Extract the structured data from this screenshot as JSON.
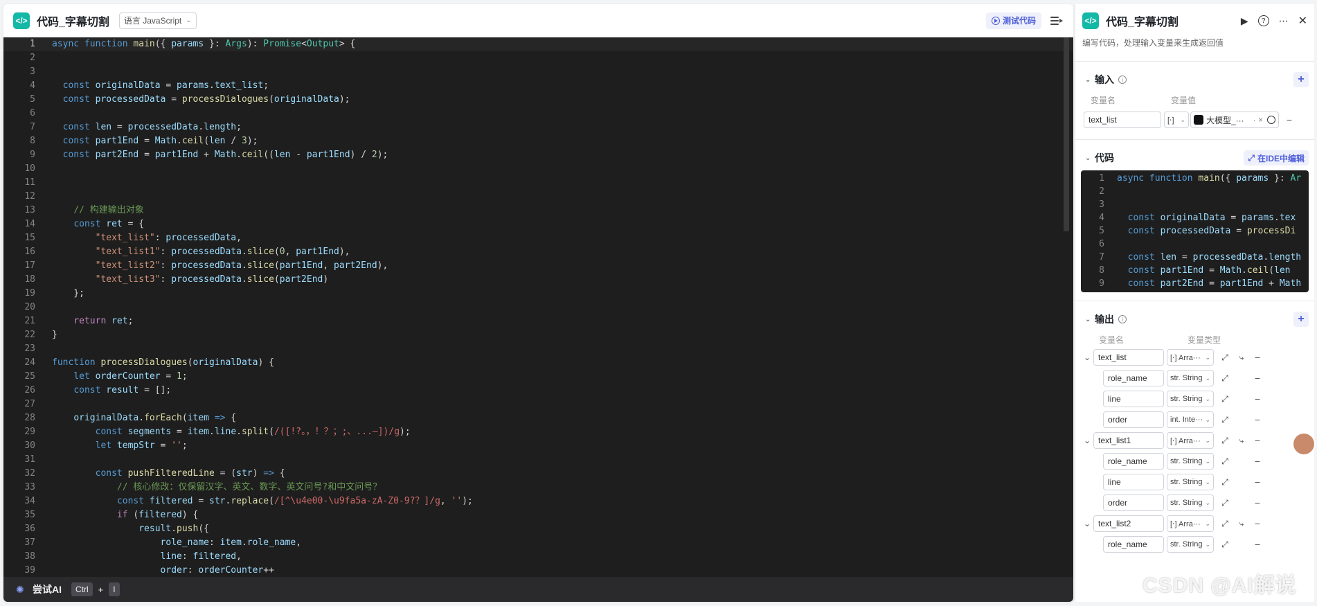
{
  "editor": {
    "title": "代码_字幕切割",
    "language": "语言 JavaScript",
    "test_button": "测试代码",
    "code_lines": [
      {
        "n": 1,
        "html": "<span class='k'>async</span> <span class='k'>function</span> <span class='f'>main</span>({ <span class='v'>params</span> }: <span class='t'>Args</span>): <span class='t'>Promise</span>&lt;<span class='t'>Output</span>&gt; {"
      },
      {
        "n": 2,
        "html": ""
      },
      {
        "n": 3,
        "html": ""
      },
      {
        "n": 4,
        "html": "  <span class='k'>const</span> <span class='v'>originalData</span> = <span class='v'>params</span>.<span class='v'>text_list</span>;"
      },
      {
        "n": 5,
        "html": "  <span class='k'>const</span> <span class='v'>processedData</span> = <span class='f'>processDialogues</span>(<span class='v'>originalData</span>);"
      },
      {
        "n": 6,
        "html": ""
      },
      {
        "n": 7,
        "html": "  <span class='k'>const</span> <span class='v'>len</span> = <span class='v'>processedData</span>.<span class='v'>length</span>;"
      },
      {
        "n": 8,
        "html": "  <span class='k'>const</span> <span class='v'>part1End</span> = <span class='v'>Math</span>.<span class='f'>ceil</span>(<span class='v'>len</span> / <span class='n'>3</span>);"
      },
      {
        "n": 9,
        "html": "  <span class='k'>const</span> <span class='v'>part2End</span> = <span class='v'>part1End</span> + <span class='v'>Math</span>.<span class='f'>ceil</span>((<span class='v'>len</span> - <span class='v'>part1End</span>) / <span class='n'>2</span>);"
      },
      {
        "n": 10,
        "html": ""
      },
      {
        "n": 11,
        "html": ""
      },
      {
        "n": 12,
        "html": ""
      },
      {
        "n": 13,
        "html": "    <span class='c'>// 构建输出对象</span>"
      },
      {
        "n": 14,
        "html": "    <span class='k'>const</span> <span class='v'>ret</span> = {"
      },
      {
        "n": 15,
        "html": "        <span class='s'>\"text_list\"</span>: <span class='v'>processedData</span>,"
      },
      {
        "n": 16,
        "html": "        <span class='s'>\"text_list1\"</span>: <span class='v'>processedData</span>.<span class='f'>slice</span>(<span class='n'>0</span>, <span class='v'>part1End</span>),"
      },
      {
        "n": 17,
        "html": "        <span class='s'>\"text_list2\"</span>: <span class='v'>processedData</span>.<span class='f'>slice</span>(<span class='v'>part1End</span>, <span class='v'>part2End</span>),"
      },
      {
        "n": 18,
        "html": "        <span class='s'>\"text_list3\"</span>: <span class='v'>processedData</span>.<span class='f'>slice</span>(<span class='v'>part2End</span>)"
      },
      {
        "n": 19,
        "html": "    };"
      },
      {
        "n": 20,
        "html": ""
      },
      {
        "n": 21,
        "html": "    <span class='kc'>return</span> <span class='v'>ret</span>;"
      },
      {
        "n": 22,
        "html": "}"
      },
      {
        "n": 23,
        "html": ""
      },
      {
        "n": 24,
        "html": "<span class='k'>function</span> <span class='f'>processDialogues</span>(<span class='v'>originalData</span>) {"
      },
      {
        "n": 25,
        "html": "    <span class='k'>let</span> <span class='v'>orderCounter</span> = <span class='n'>1</span>;"
      },
      {
        "n": 26,
        "html": "    <span class='k'>const</span> <span class='v'>result</span> = [];"
      },
      {
        "n": 27,
        "html": ""
      },
      {
        "n": 28,
        "html": "    <span class='v'>originalData</span>.<span class='f'>forEach</span>(<span class='v'>item</span> <span class='k'>=&gt;</span> {"
      },
      {
        "n": 29,
        "html": "        <span class='k'>const</span> <span class='v'>segments</span> = <span class='v'>item</span>.<span class='v'>line</span>.<span class='f'>split</span>(<span class='r'>/([!?。，！？；;、...—])/g</span>);"
      },
      {
        "n": 30,
        "html": "        <span class='k'>let</span> <span class='v'>tempStr</span> = <span class='s'>''</span>;"
      },
      {
        "n": 31,
        "html": ""
      },
      {
        "n": 32,
        "html": "        <span class='k'>const</span> <span class='f'>pushFilteredLine</span> = (<span class='v'>str</span>) <span class='k'>=&gt;</span> {"
      },
      {
        "n": 33,
        "html": "            <span class='c'>// 核心修改：仅保留汉字、英文、数字、英文问号?和中文问号？</span>"
      },
      {
        "n": 34,
        "html": "            <span class='k'>const</span> <span class='v'>filtered</span> = <span class='v'>str</span>.<span class='f'>replace</span>(<span class='r'>/[^\\u4e00-\\u9fa5a-zA-Z0-9?？]/g</span>, <span class='s'>''</span>);"
      },
      {
        "n": 35,
        "html": "            <span class='kc'>if</span> (<span class='v'>filtered</span>) {"
      },
      {
        "n": 36,
        "html": "                <span class='v'>result</span>.<span class='f'>push</span>({"
      },
      {
        "n": 37,
        "html": "                    <span class='v'>role_name</span>: <span class='v'>item</span>.<span class='v'>role_name</span>,"
      },
      {
        "n": 38,
        "html": "                    <span class='v'>line</span>: <span class='v'>filtered</span>,"
      },
      {
        "n": 39,
        "html": "                    <span class='v'>order</span>: <span class='v'>orderCounter</span>++"
      }
    ],
    "footer": {
      "ai_label": "尝试AI",
      "key1": "Ctrl",
      "plus": "+",
      "key2": "I"
    }
  },
  "panel": {
    "title": "代码_字幕切割",
    "description": "编写代码，处理输入变量来生成返回值",
    "input": {
      "label": "输入",
      "col_name": "变量名",
      "col_value": "变量值",
      "var_name": "text_list",
      "var_type": "[⋅]",
      "ref_value": "大模型_···",
      "ref_suffix": "· ×"
    },
    "code": {
      "label": "代码",
      "ide_button": "在IDE中编辑",
      "preview_lines": [
        {
          "n": 1,
          "html": "<span class='k'>async</span> <span class='k'>function</span> <span class='f'>main</span>({ <span class='v'>params</span> }: <span class='t'>Ar</span>"
        },
        {
          "n": 2,
          "html": ""
        },
        {
          "n": 3,
          "html": ""
        },
        {
          "n": 4,
          "html": "  <span class='k'>const</span> <span class='v'>originalData</span> = <span class='v'>params</span>.<span class='v'>tex</span>"
        },
        {
          "n": 5,
          "html": "  <span class='k'>const</span> <span class='v'>processedData</span> = <span class='f'>processDi</span>"
        },
        {
          "n": 6,
          "html": ""
        },
        {
          "n": 7,
          "html": "  <span class='k'>const</span> <span class='v'>len</span> = <span class='v'>processedData</span>.<span class='v'>length</span>"
        },
        {
          "n": 8,
          "html": "  <span class='k'>const</span> <span class='v'>part1End</span> = <span class='v'>Math</span>.<span class='f'>ceil</span>(<span class='v'>len</span>"
        },
        {
          "n": 9,
          "html": "  <span class='k'>const</span> <span class='v'>part2End</span> = <span class='v'>part1End</span> + <span class='v'>Math</span>"
        }
      ]
    },
    "output": {
      "label": "输出",
      "col_name": "变量名",
      "col_type": "变量类型",
      "rows": [
        {
          "name": "text_list",
          "type": "[⋅] Arra···",
          "level": 0,
          "expandable": true
        },
        {
          "name": "role_name",
          "type": "str. String",
          "level": 1,
          "expandable": false
        },
        {
          "name": "line",
          "type": "str. String",
          "level": 1,
          "expandable": false
        },
        {
          "name": "order",
          "type": "int. Inte···",
          "level": 1,
          "expandable": false
        },
        {
          "name": "text_list1",
          "type": "[⋅] Arra···",
          "level": 0,
          "expandable": true
        },
        {
          "name": "role_name",
          "type": "str. String",
          "level": 1,
          "expandable": false
        },
        {
          "name": "line",
          "type": "str. String",
          "level": 1,
          "expandable": false
        },
        {
          "name": "order",
          "type": "str. String",
          "level": 1,
          "expandable": false
        },
        {
          "name": "text_list2",
          "type": "[⋅] Arra···",
          "level": 0,
          "expandable": true
        },
        {
          "name": "role_name",
          "type": "str. String",
          "level": 1,
          "expandable": false
        }
      ]
    }
  },
  "watermark": "CSDN @AI解说",
  "colors": {
    "accent": "#4f5fd8",
    "code_bg": "#1e1e1e",
    "logo": "#14b8a6"
  }
}
